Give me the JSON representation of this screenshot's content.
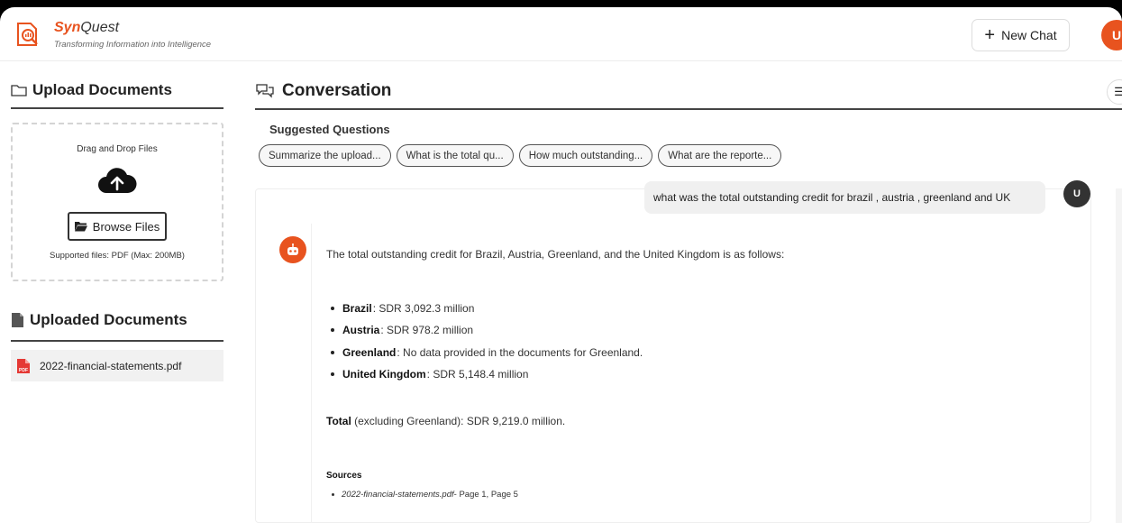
{
  "header": {
    "brand_part1": "Syn",
    "brand_part2": "Quest",
    "tagline": "Transforming Information into Intelligence",
    "new_chat_label": "New Chat",
    "user_initial": "U"
  },
  "sidebar": {
    "upload_title": "Upload Documents",
    "dropzone": {
      "label": "Drag and Drop Files",
      "browse_label": "Browse Files",
      "supported": "Supported files: PDF (Max: 200MB)"
    },
    "uploaded_title": "Uploaded Documents",
    "files": [
      {
        "name": "2022-financial-statements.pdf",
        "icon": "pdf-file-icon"
      }
    ]
  },
  "conversation": {
    "title": "Conversation",
    "suggested_title": "Suggested Questions",
    "suggestions": [
      "Summarize the upload...",
      "What is the total qu...",
      "How much outstanding...",
      "What are the reporte..."
    ],
    "user_message": "what was the total outstanding credit for brazil , austria , greenland and UK",
    "user_avatar": "U",
    "bot_reply": {
      "intro": "The total outstanding credit for Brazil, Austria, Greenland, and the United Kingdom is as follows:",
      "items": [
        {
          "label": "Brazil",
          "value": ": SDR 3,092.3 million"
        },
        {
          "label": "Austria",
          "value": ": SDR 978.2 million"
        },
        {
          "label": "Greenland",
          "value": ": No data provided in the documents for Greenland."
        },
        {
          "label": "United Kingdom",
          "value": ": SDR 5,148.4 million"
        }
      ],
      "total_label": "Total",
      "total_value": " (excluding Greenland): SDR 9,219.0 million.",
      "sources_title": "Sources",
      "source_file": "2022-financial-statements.pdf",
      "source_pages": " - Page 1, Page 5"
    }
  },
  "colors": {
    "accent": "#e8531f",
    "text": "#222222",
    "chip_bg": "#f7f7f7"
  }
}
